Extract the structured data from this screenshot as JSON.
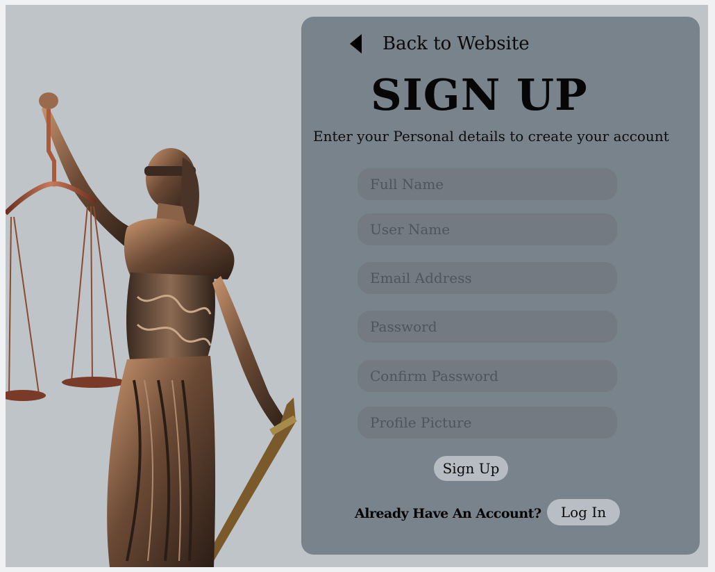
{
  "header": {
    "back_label": "Back to Website",
    "back_icon": "triangle-left-icon"
  },
  "form": {
    "title": "SIGN UP",
    "subtitle": "Enter your Personal details to create your account",
    "fields": {
      "full_name": {
        "placeholder": "Full Name",
        "value": ""
      },
      "user_name": {
        "placeholder": "User Name",
        "value": ""
      },
      "email": {
        "placeholder": "Email Address",
        "value": ""
      },
      "password": {
        "placeholder": "Password",
        "value": ""
      },
      "confirm_password": {
        "placeholder": "Confirm Password",
        "value": ""
      },
      "profile_picture": {
        "placeholder": "Profile Picture",
        "value": ""
      }
    },
    "submit_label": "Sign Up"
  },
  "footer": {
    "already_text": "Already Have An Account?",
    "login_label": "Log In"
  },
  "image": {
    "subject": "lady-justice-statue"
  },
  "colors": {
    "page_background": "#bfc4c8",
    "card_background": "#79838c",
    "field_background": "#737a82",
    "button_background": "#b7bcc2"
  }
}
